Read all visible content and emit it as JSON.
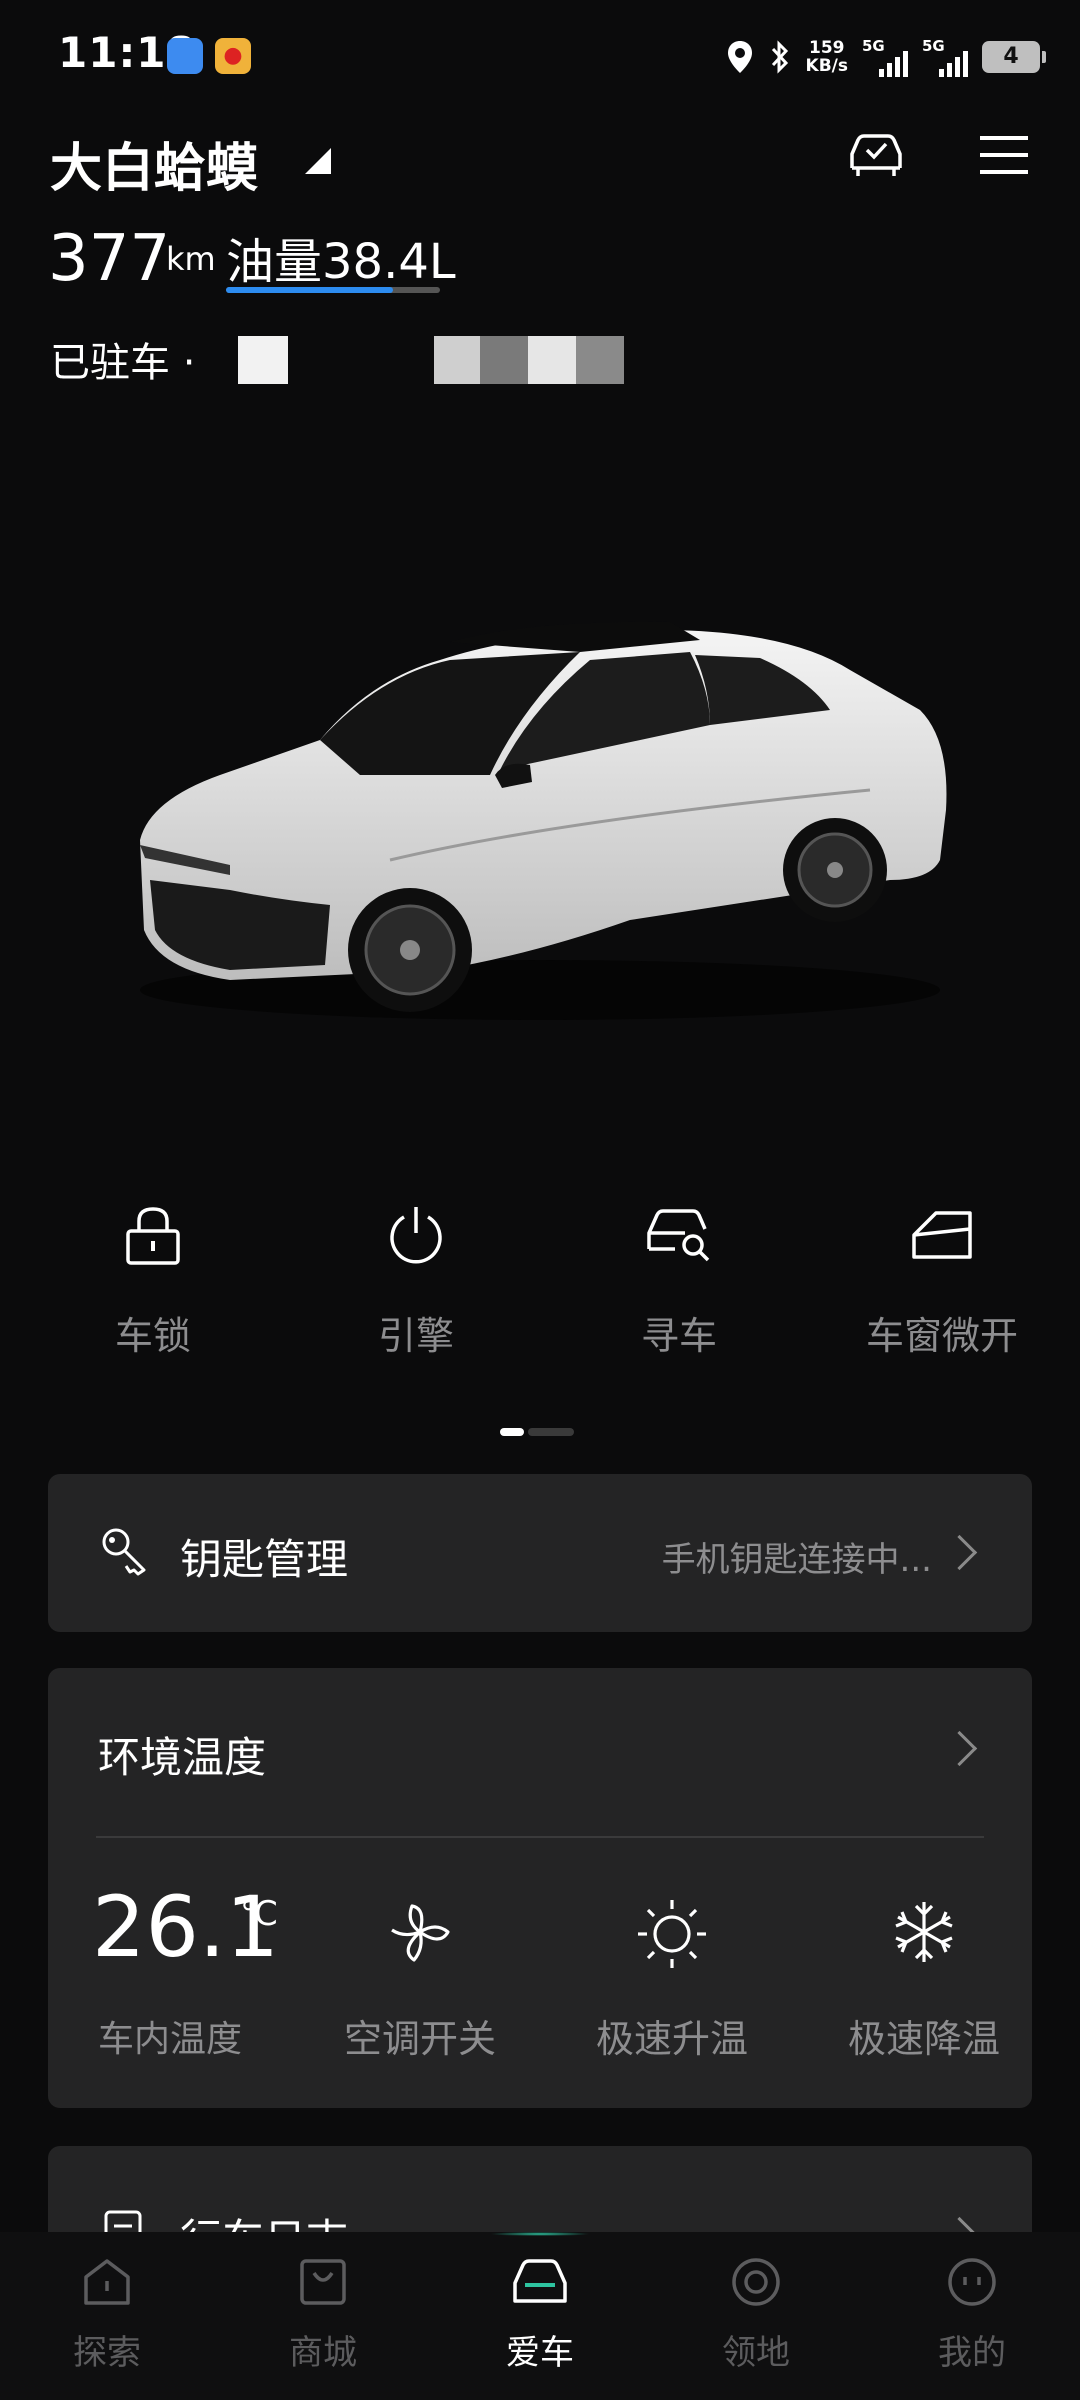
{
  "status_bar": {
    "time": "11:18",
    "speed_value": "159",
    "speed_unit": "KB/s",
    "network_1": "5G",
    "network_2": "5G",
    "battery": "4"
  },
  "header": {
    "car_name": "大白蛤蟆",
    "range_value": "377",
    "range_unit": "km",
    "fuel_label": "油量38.4L",
    "fuel_level_fraction": 0.78,
    "park_status": "已驻车 · "
  },
  "quick_actions": [
    {
      "label": "车锁",
      "icon": "lock-icon"
    },
    {
      "label": "引擎",
      "icon": "power-icon"
    },
    {
      "label": "寻车",
      "icon": "car-search-icon"
    },
    {
      "label": "车窗微开",
      "icon": "window-icon"
    }
  ],
  "pager": {
    "active_index": 0,
    "count": 2
  },
  "key_card": {
    "title": "钥匙管理",
    "status": "手机钥匙连接中..."
  },
  "env_card": {
    "title": "环境温度",
    "temp_value": "26.1",
    "temp_unit": "℃",
    "temp_label": "车内温度",
    "controls": [
      {
        "label": "空调开关",
        "icon": "fan-icon"
      },
      {
        "label": "极速升温",
        "icon": "sun-icon"
      },
      {
        "label": "极速降温",
        "icon": "snowflake-icon"
      }
    ]
  },
  "log_card": {
    "title": "行车日志"
  },
  "bottom_nav": [
    {
      "label": "探索",
      "icon": "explore-icon",
      "active": false
    },
    {
      "label": "商城",
      "icon": "shop-icon",
      "active": false
    },
    {
      "label": "爱车",
      "icon": "car-icon",
      "active": true
    },
    {
      "label": "领地",
      "icon": "territory-icon",
      "active": false
    },
    {
      "label": "我的",
      "icon": "profile-icon",
      "active": false
    }
  ],
  "colors": {
    "background": "#0b0b0c",
    "card": "#242425",
    "accent_blue": "#2d8cf0",
    "nav_active": "#ffffff",
    "nav_inactive": "#5c5c5e"
  }
}
